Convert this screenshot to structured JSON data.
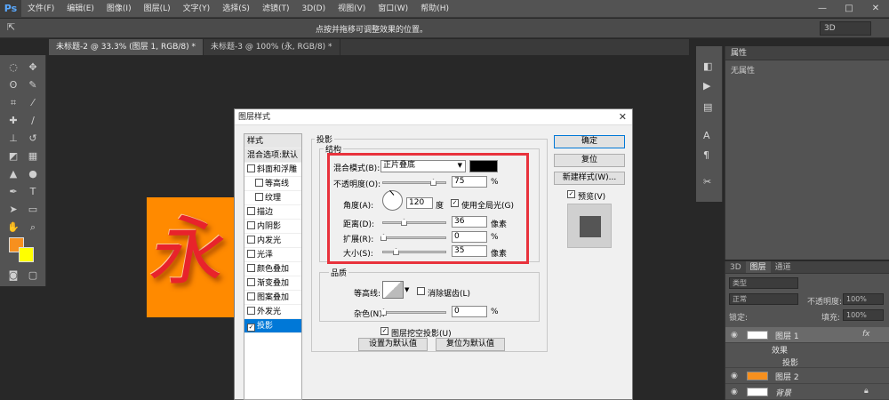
{
  "app_logo": "Ps",
  "menu": [
    "文件(F)",
    "编辑(E)",
    "图像(I)",
    "图层(L)",
    "文字(Y)",
    "选择(S)",
    "滤镜(T)",
    "3D(D)",
    "视图(V)",
    "窗口(W)",
    "帮助(H)"
  ],
  "window_controls": [
    "—",
    "□",
    "✕"
  ],
  "options_bar": {
    "hint": "点按并拖移可调整效果的位置。",
    "workspace": "3D"
  },
  "tabs": [
    "未标题-2 @ 33.3% (图层 1, RGB/8) *",
    "未标题-3 @ 100% (永, RGB/8) *"
  ],
  "artwork_text": "永",
  "colors": {
    "foreground": "#f7901e",
    "background": "#ffff00",
    "highlight": "#e8323c",
    "accent": "#0078d7"
  },
  "properties_panel": {
    "title": "属性",
    "empty_text": "无属性"
  },
  "layers_panel": {
    "tabs": [
      "3D",
      "图层",
      "通道"
    ],
    "filter": "类型",
    "blend_mode": "正常",
    "opacity_label": "不透明度:",
    "opacity_value": "100%",
    "lock_label": "锁定:",
    "fill_label": "填充:",
    "fill_value": "100%",
    "layers": [
      {
        "name": "图层 1",
        "fx": "fx"
      },
      {
        "name": "效果"
      },
      {
        "name": "投影"
      },
      {
        "name": "图层 2"
      },
      {
        "name": "背景"
      }
    ]
  },
  "dialog": {
    "title": "图层样式",
    "close": "✕",
    "style_list": [
      {
        "label": "样式",
        "type": "header"
      },
      {
        "label": "混合选项:默认",
        "type": "header"
      },
      {
        "label": "斜面和浮雕",
        "checked": false
      },
      {
        "label": "等高线",
        "checked": false,
        "indent": true
      },
      {
        "label": "纹理",
        "checked": false,
        "indent": true
      },
      {
        "label": "描边",
        "checked": false
      },
      {
        "label": "内阴影",
        "checked": false
      },
      {
        "label": "内发光",
        "checked": false
      },
      {
        "label": "光泽",
        "checked": false
      },
      {
        "label": "颜色叠加",
        "checked": false
      },
      {
        "label": "渐变叠加",
        "checked": false
      },
      {
        "label": "图案叠加",
        "checked": false
      },
      {
        "label": "外发光",
        "checked": false
      },
      {
        "label": "投影",
        "checked": true,
        "selected": true
      }
    ],
    "section_title": "投影",
    "structure": {
      "legend": "结构",
      "blend_mode_label": "混合模式(B):",
      "blend_mode_value": "正片叠底",
      "shadow_color": "#000000",
      "opacity_label": "不透明度(O):",
      "opacity_value": "75",
      "angle_label": "角度(A):",
      "angle_value": "120",
      "angle_unit": "度",
      "global_light_label": "使用全局光(G)",
      "global_light_checked": true,
      "distance_label": "距离(D):",
      "distance_value": "36",
      "distance_unit": "像素",
      "spread_label": "扩展(R):",
      "spread_value": "0",
      "size_label": "大小(S):",
      "size_value": "35",
      "size_unit": "像素",
      "percent": "%"
    },
    "quality": {
      "legend": "品质",
      "contour_label": "等高线:",
      "antialias_label": "消除锯齿(L)",
      "antialias_checked": false,
      "noise_label": "杂色(N):",
      "noise_value": "0",
      "percent": "%"
    },
    "knockout_label": "图层挖空投影(U)",
    "knockout_checked": true,
    "set_default": "设置为默认值",
    "reset_default": "复位为默认值",
    "buttons": {
      "ok": "确定",
      "reset": "复位",
      "new_style": "新建样式(W)...",
      "preview": "预览(V)",
      "preview_checked": true
    }
  }
}
